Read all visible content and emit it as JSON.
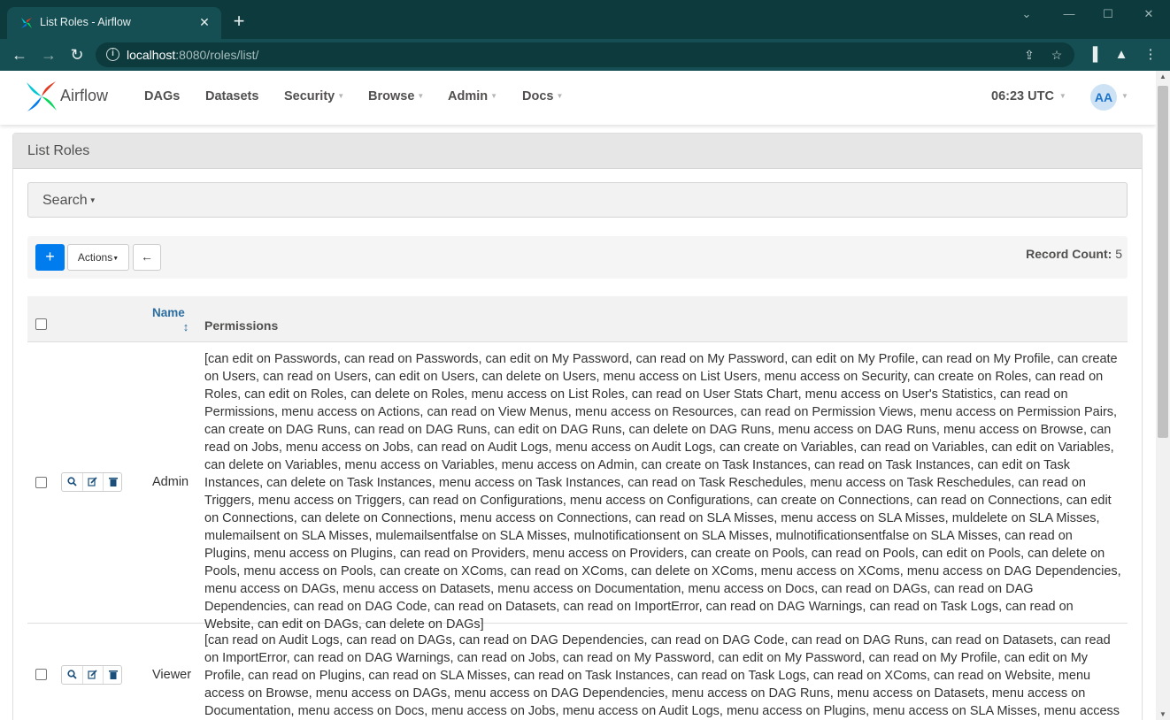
{
  "browser": {
    "tab_title": "List Roles - Airflow",
    "tab_close": "✕",
    "new_tab": "+",
    "url_host": "localhost",
    "url_rest": ":8080/roles/list/"
  },
  "navbar": {
    "brand": "Airflow",
    "items": [
      {
        "label": "DAGs",
        "has_menu": false
      },
      {
        "label": "Datasets",
        "has_menu": false
      },
      {
        "label": "Security",
        "has_menu": true
      },
      {
        "label": "Browse",
        "has_menu": true
      },
      {
        "label": "Admin",
        "has_menu": true
      },
      {
        "label": "Docs",
        "has_menu": true
      }
    ],
    "clock": "06:23 UTC",
    "user_initials": "AA"
  },
  "panel": {
    "title": "List Roles",
    "search_label": "Search",
    "actions_label": "Actions",
    "add_symbol": "+",
    "back_symbol": "←",
    "record_count_label": "Record Count:",
    "record_count": "5"
  },
  "table": {
    "columns": {
      "name": "Name",
      "permissions": "Permissions"
    },
    "rows": [
      {
        "name": "Admin",
        "permissions": "[can edit on Passwords, can read on Passwords, can edit on My Password, can read on My Password, can edit on My Profile, can read on My Profile, can create on Users, can read on Users, can edit on Users, can delete on Users, menu access on List Users, menu access on Security, can create on Roles, can read on Roles, can edit on Roles, can delete on Roles, menu access on List Roles, can read on User Stats Chart, menu access on User's Statistics, can read on Permissions, menu access on Actions, can read on View Menus, menu access on Resources, can read on Permission Views, menu access on Permission Pairs, can create on DAG Runs, can read on DAG Runs, can edit on DAG Runs, can delete on DAG Runs, menu access on DAG Runs, menu access on Browse, can read on Jobs, menu access on Jobs, can read on Audit Logs, menu access on Audit Logs, can create on Variables, can read on Variables, can edit on Variables, can delete on Variables, menu access on Variables, menu access on Admin, can create on Task Instances, can read on Task Instances, can edit on Task Instances, can delete on Task Instances, menu access on Task Instances, can read on Task Reschedules, menu access on Task Reschedules, can read on Triggers, menu access on Triggers, can read on Configurations, menu access on Configurations, can create on Connections, can read on Connections, can edit on Connections, can delete on Connections, menu access on Connections, can read on SLA Misses, menu access on SLA Misses, muldelete on SLA Misses, mulemailsent on SLA Misses, mulemailsentfalse on SLA Misses, mulnotificationsent on SLA Misses, mulnotificationsentfalse on SLA Misses, can read on Plugins, menu access on Plugins, can read on Providers, menu access on Providers, can create on Pools, can read on Pools, can edit on Pools, can delete on Pools, menu access on Pools, can create on XComs, can read on XComs, can delete on XComs, menu access on XComs, menu access on DAG Dependencies, menu access on DAGs, menu access on Datasets, menu access on Documentation, menu access on Docs, can read on DAGs, can read on DAG Dependencies, can read on DAG Code, can read on Datasets, can read on ImportError, can read on DAG Warnings, can read on Task Logs, can read on Website, can edit on DAGs, can delete on DAGs]"
      },
      {
        "name": "Viewer",
        "permissions": "[can read on Audit Logs, can read on DAGs, can read on DAG Dependencies, can read on DAG Code, can read on DAG Runs, can read on Datasets, can read on ImportError, can read on DAG Warnings, can read on Jobs, can read on My Password, can edit on My Password, can read on My Profile, can edit on My Profile, can read on Plugins, can read on SLA Misses, can read on Task Instances, can read on Task Logs, can read on XComs, can read on Website, menu access on Browse, menu access on DAGs, menu access on DAG Dependencies, menu access on DAG Runs, menu access on Datasets, menu access on Documentation, menu access on Docs, menu access on Jobs, menu access on Audit Logs, menu access on Plugins, menu access on SLA Misses, menu access on Task Instances]"
      }
    ]
  },
  "colors": {
    "primary": "#017cee",
    "link": "#2c6ea0",
    "browser_frame": "#0c3a3d"
  }
}
